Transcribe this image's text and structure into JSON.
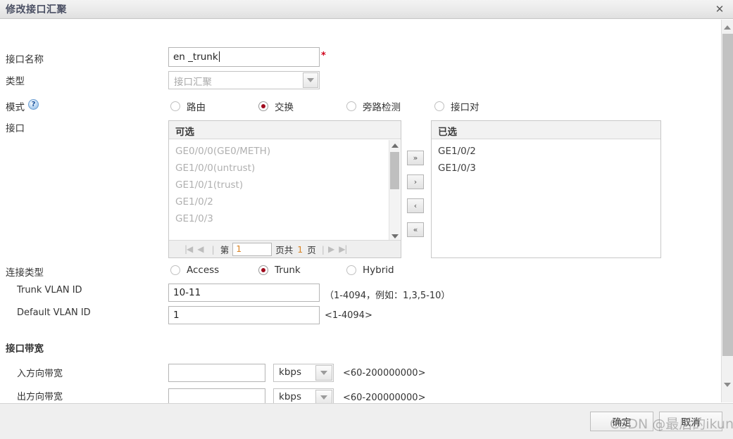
{
  "window": {
    "title": "修改接口汇聚",
    "close_icon": "close-icon"
  },
  "form": {
    "interface_name": {
      "label": "接口名称",
      "value": "en _trunk",
      "required_mark": "*"
    },
    "type": {
      "label": "类型",
      "value": "接口汇聚",
      "disabled": true
    },
    "mode": {
      "label": "模式",
      "help_icon": "?",
      "options": [
        {
          "label": "路由",
          "checked": false
        },
        {
          "label": "交换",
          "checked": true
        },
        {
          "label": "旁路检测",
          "checked": false
        },
        {
          "label": "接口对",
          "checked": false
        }
      ]
    },
    "interface": {
      "label": "接口",
      "available": {
        "header": "可选",
        "items": [
          "GE0/0/0(GE0/METH)",
          "GE1/0/0(untrust)",
          "GE1/0/1(trust)",
          "GE1/0/2",
          "GE1/0/3"
        ],
        "pager": {
          "first_icon": "|◀",
          "prev_icon": "◀",
          "page_prefix": "第",
          "page_value": "1",
          "page_suffix_a": "页共",
          "total_pages": "1",
          "page_suffix_b": "页",
          "next_icon": "▶",
          "last_icon": "▶|"
        }
      },
      "transfer_buttons": [
        {
          "name": "move-all-right-button",
          "glyph": "»"
        },
        {
          "name": "move-right-button",
          "glyph": "›"
        },
        {
          "name": "move-left-button",
          "glyph": "‹"
        },
        {
          "name": "move-all-left-button",
          "glyph": "«"
        }
      ],
      "selected": {
        "header": "已选",
        "items": [
          "GE1/0/2",
          "GE1/0/3"
        ]
      }
    },
    "link_type": {
      "label": "连接类型",
      "options": [
        {
          "label": "Access",
          "checked": false
        },
        {
          "label": "Trunk",
          "checked": true
        },
        {
          "label": "Hybrid",
          "checked": false
        }
      ]
    },
    "trunk_vlan_id": {
      "label": "Trunk VLAN ID",
      "value": "10-11",
      "hint": "（1-4094，例如：1,3,5-10）"
    },
    "default_vlan_id": {
      "label": "Default VLAN ID",
      "value": "1",
      "hint": "<1-4094>"
    },
    "bandwidth_section": {
      "title": "接口带宽",
      "inbound": {
        "label": "入方向带宽",
        "value": "",
        "unit": "kbps",
        "hint": "<60-200000000>"
      },
      "outbound": {
        "label": "出方向带宽",
        "value": "",
        "unit": "kbps",
        "hint": "<60-200000000>"
      }
    }
  },
  "footer": {
    "ok_label": "确定",
    "cancel_label": "取消"
  },
  "watermark": {
    "text": "CSDN @最后的ikun"
  }
}
